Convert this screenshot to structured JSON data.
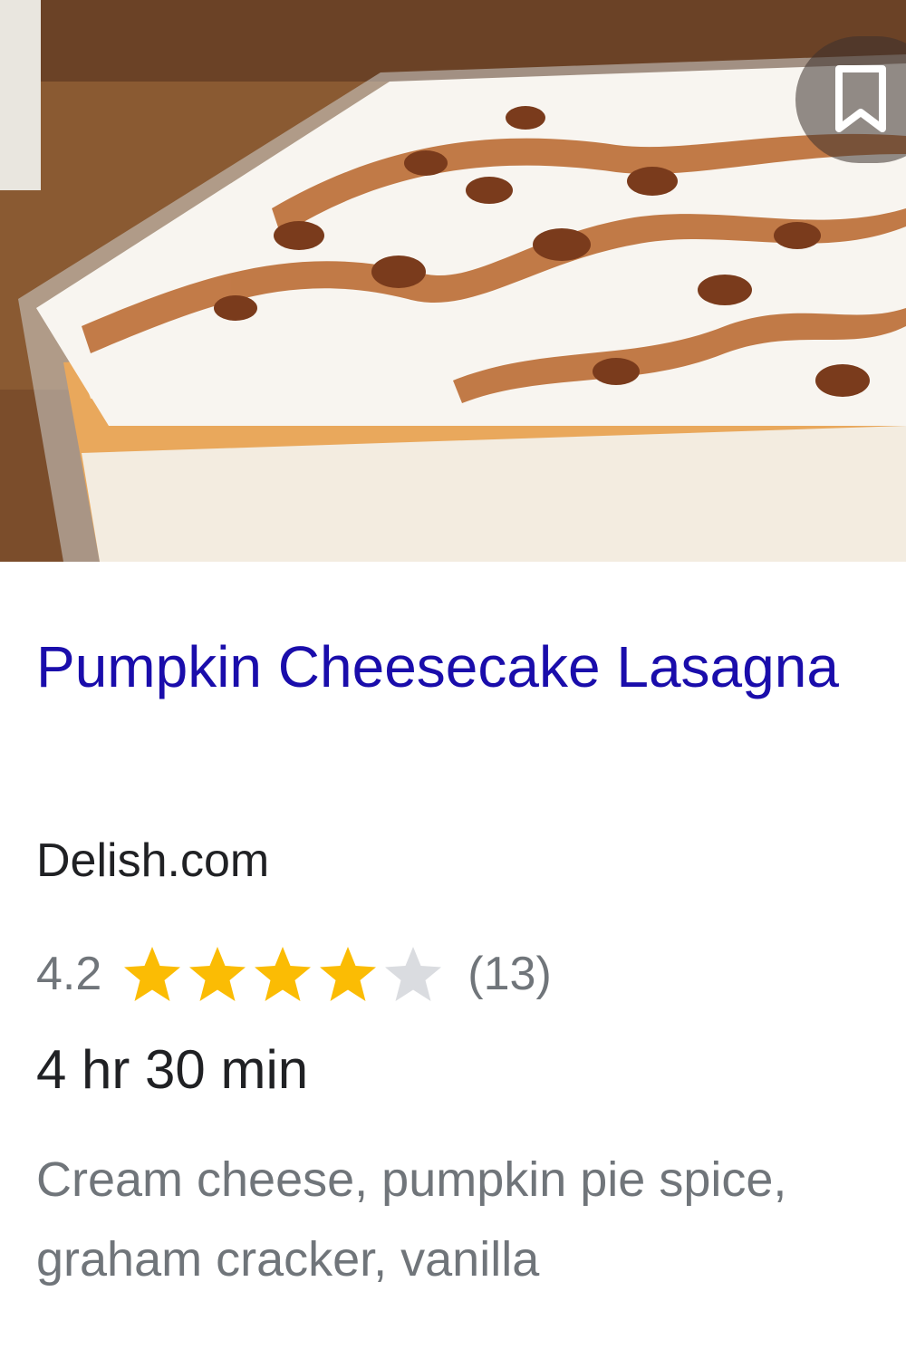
{
  "recipe": {
    "title": "Pumpkin Cheesecake Lasagna",
    "source": "Delish.com",
    "rating": {
      "value": "4.2",
      "stars_filled": 4,
      "stars_total": 5,
      "reviews": "(13)"
    },
    "time": "4 hr 30 min",
    "ingredients": "Cream cheese, pumpkin pie spice, graham cracker, vanilla"
  },
  "icons": {
    "bookmark": "bookmark-icon",
    "star": "star-icon"
  },
  "colors": {
    "title": "#1a0dab",
    "source": "#202124",
    "muted": "#70757a",
    "star_filled": "#fbbc04",
    "star_empty": "#dadce0"
  }
}
